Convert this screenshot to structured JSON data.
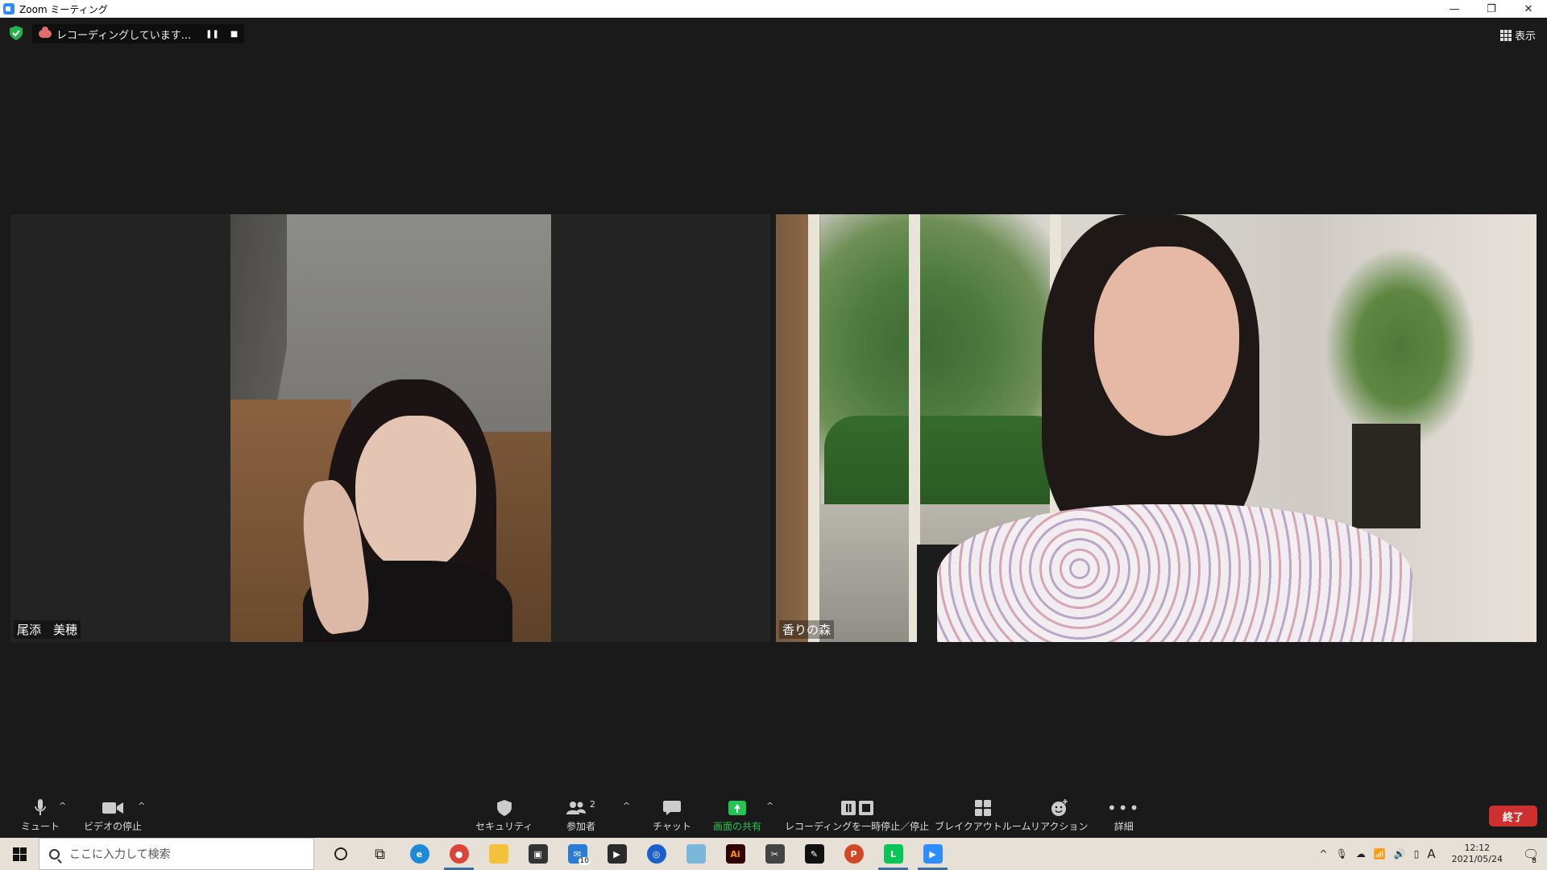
{
  "window": {
    "title": "Zoom ミーティング"
  },
  "top_bar": {
    "recording_text": "レコーディングしています...",
    "view_label": "表示"
  },
  "participants": [
    {
      "name": "尾添　美穂"
    },
    {
      "name": "香りの森"
    }
  ],
  "toolbar": {
    "mute_label": "ミュート",
    "video_label": "ビデオの停止",
    "security_label": "セキュリティ",
    "participants_label": "参加者",
    "participants_count": "2",
    "chat_label": "チャット",
    "share_label": "画面の共有",
    "recording_label": "レコーディングを一時停止／停止",
    "breakout_label": "ブレイクアウトルーム",
    "reaction_label": "リアクション",
    "more_label": "詳細",
    "end_label": "終了"
  },
  "taskbar": {
    "search_placeholder": "ここに入力して検索",
    "mail_badge": "10",
    "ime_label": "A",
    "time": "12:12",
    "date": "2021/05/24",
    "notif_badge": "8"
  },
  "colors": {
    "share_green": "#23c451",
    "end_red": "#d02f2f",
    "zoom_blue": "#2d8cff"
  }
}
